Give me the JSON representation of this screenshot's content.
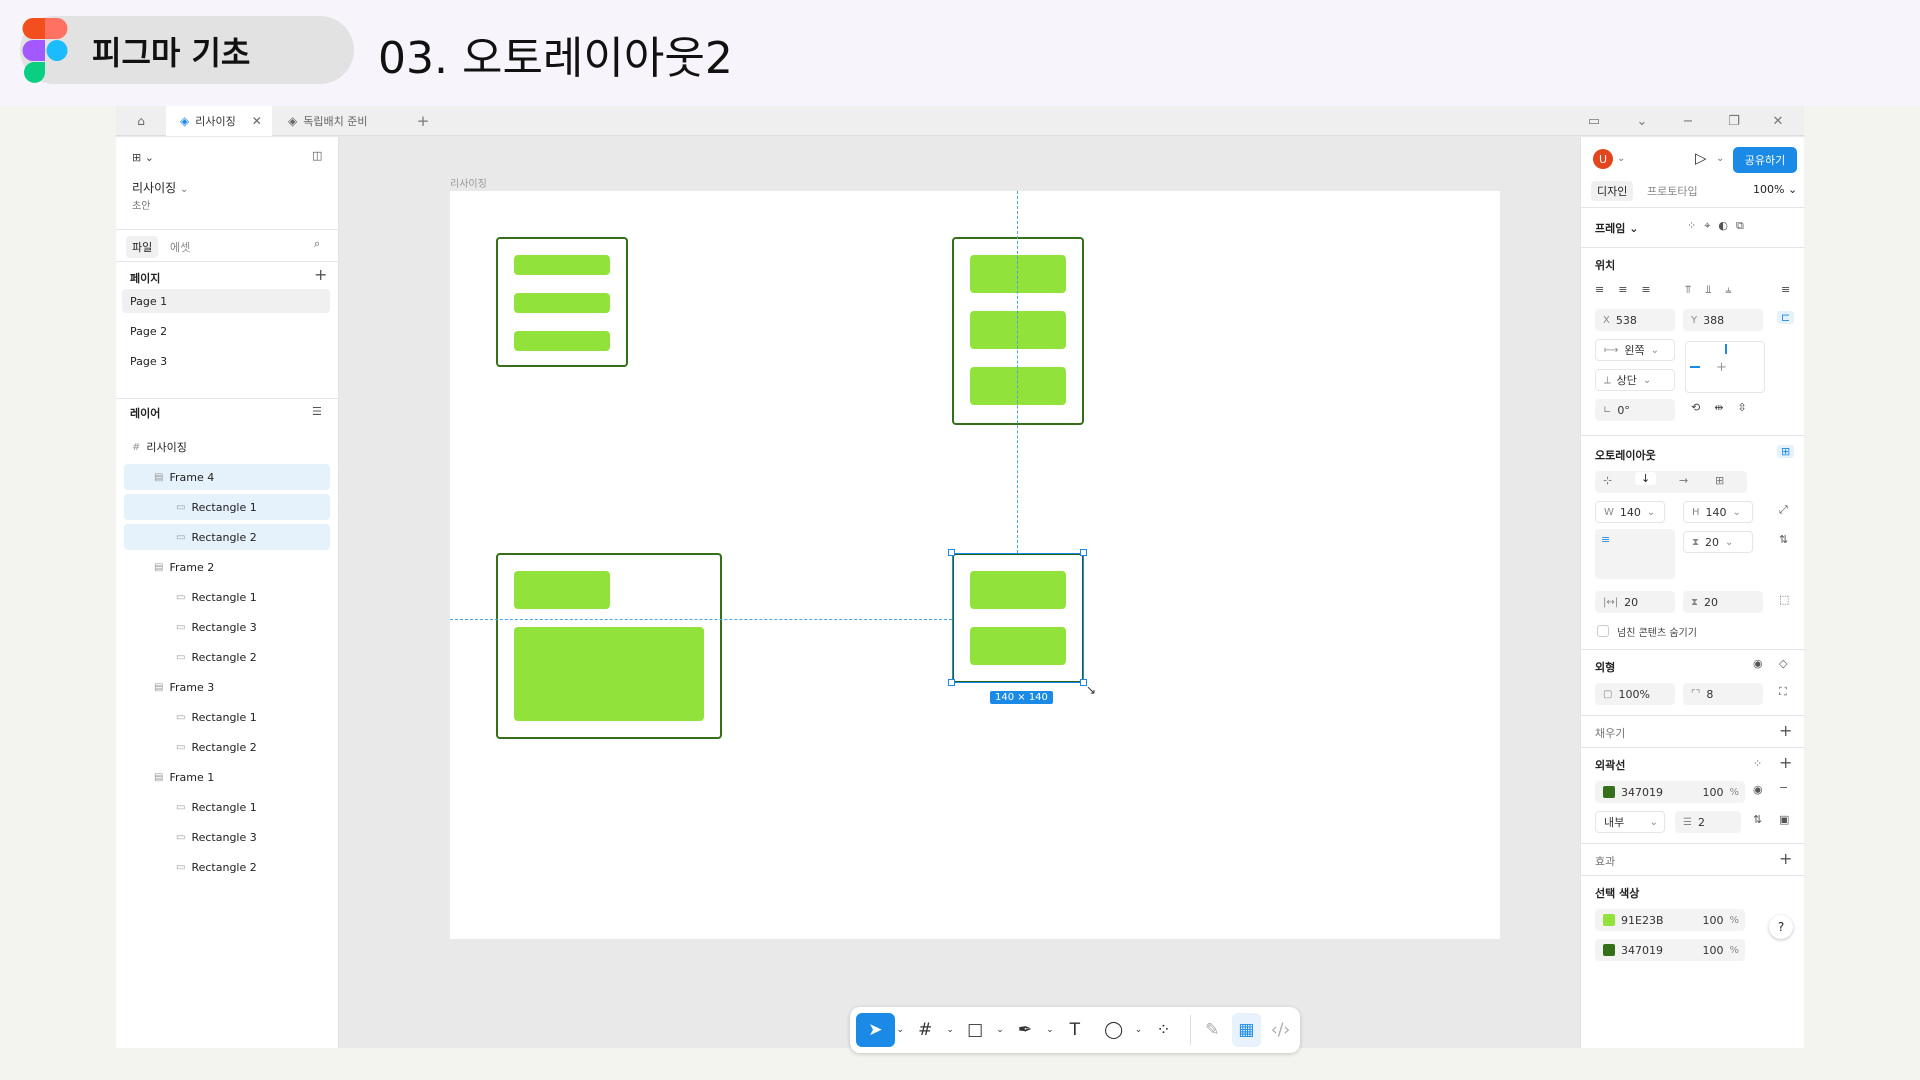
{
  "header": {
    "course_title": "피그마 기초",
    "lesson_title": "03. 오토레이아웃2"
  },
  "tabs": [
    {
      "label": "리사이징",
      "active": true
    },
    {
      "label": "독립배치 준비",
      "active": false
    }
  ],
  "left_panel": {
    "file_name": "리사이징",
    "file_sub": "초안",
    "tab_file": "파일",
    "tab_assets": "에셋",
    "pages_title": "페이지",
    "pages": [
      "Page 1",
      "Page 2",
      "Page 3"
    ],
    "layers_title": "레이어",
    "layers": [
      {
        "label": "리사이징",
        "indent": 0,
        "icon": "frame-grid-icon"
      },
      {
        "label": "Frame 4",
        "indent": 1,
        "selected": true
      },
      {
        "label": "Rectangle 1",
        "indent": 2,
        "selected": true
      },
      {
        "label": "Rectangle 2",
        "indent": 2,
        "selected": true
      },
      {
        "label": "Frame 2",
        "indent": 1
      },
      {
        "label": "Rectangle 1",
        "indent": 2
      },
      {
        "label": "Rectangle 3",
        "indent": 2
      },
      {
        "label": "Rectangle 2",
        "indent": 2
      },
      {
        "label": "Frame 3",
        "indent": 1
      },
      {
        "label": "Rectangle 1",
        "indent": 2
      },
      {
        "label": "Rectangle 2",
        "indent": 2
      },
      {
        "label": "Frame 1",
        "indent": 1
      },
      {
        "label": "Rectangle 1",
        "indent": 2
      },
      {
        "label": "Rectangle 3",
        "indent": 2
      },
      {
        "label": "Rectangle 2",
        "indent": 2
      }
    ]
  },
  "canvas": {
    "artboard_label": "리사이징",
    "selection_size": "140 × 140"
  },
  "right_panel": {
    "avatar_letter": "U",
    "share_label": "공유하기",
    "tab_design": "디자인",
    "tab_prototype": "프로토타입",
    "zoom": "100%",
    "frame_label": "프레임",
    "position_title": "위치",
    "x_label": "X",
    "x_value": "538",
    "y_label": "Y",
    "y_value": "388",
    "h_constraint": "왼쪽",
    "v_constraint": "상단",
    "rotation": "0°",
    "autolayout_title": "오토레이아웃",
    "w_label": "W",
    "w_value": "140",
    "h_label": "H",
    "h_value": "140",
    "gap_value": "20",
    "padding_h": "20",
    "padding_v": "20",
    "clip_label": "넘친 콘텐츠 숨기기",
    "appearance_title": "외형",
    "opacity": "100%",
    "radius": "8",
    "fill_title": "채우기",
    "stroke_title": "외곽선",
    "stroke_color": "347019",
    "stroke_opacity": "100",
    "stroke_pct": "%",
    "stroke_position": "내부",
    "stroke_width": "2",
    "effects_title": "효과",
    "selection_colors_title": "선택 색상",
    "selection_colors": [
      {
        "hex": "91E23B",
        "opacity": "100",
        "pct": "%",
        "color": "#91E23B"
      },
      {
        "hex": "347019",
        "opacity": "100",
        "pct": "%",
        "color": "#347019"
      }
    ],
    "help": "?"
  },
  "colors": {
    "fill_green": "#91E23B",
    "stroke_green": "#347019",
    "accent_blue": "#1a8ae6"
  }
}
